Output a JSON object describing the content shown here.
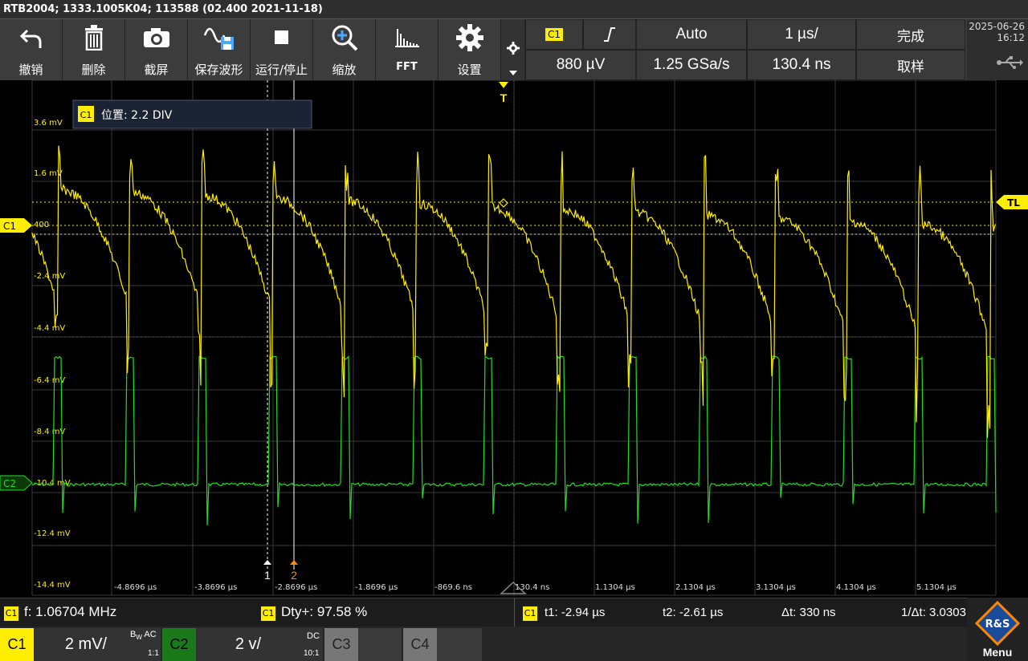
{
  "title_bar": "RTB2004; 1333.1005K04; 113588 (02.400 2021-11-18)",
  "toolbar": {
    "undo_label": "撤销",
    "delete_label": "删除",
    "screenshot_label": "截屏",
    "save_waveform_label": "保存波形",
    "run_stop_label": "运行/停止",
    "zoom_label": "缩放",
    "fft_label": "FFT",
    "settings_label": "设置"
  },
  "trigger": {
    "channel": "C1",
    "slope_icon": "rising-edge-icon",
    "mode": "Auto",
    "level": "880 µV",
    "sample_rate": "1.25 GSa/s"
  },
  "timebase": {
    "scale": "1 µs/",
    "offset": "130.4 ns"
  },
  "acquisition": {
    "status": "完成",
    "mode": "取样"
  },
  "datetime": {
    "date": "2025-06-26",
    "time": "16:12"
  },
  "usb_icon": "usb-icon",
  "position_tooltip": {
    "channel": "C1",
    "text": "位置: 2.2 DIV"
  },
  "markers": {
    "trigger": "T",
    "trigger_level": "TL",
    "ch1": "C1",
    "ch2": "C2",
    "cursor1": "1",
    "cursor2": "2"
  },
  "y_ticks": [
    "3.6 mV",
    "1.6 mV",
    "400",
    "-2.4 mV",
    "-4.4 mV",
    "-6.4 mV",
    "-8.4 mV",
    "-10.4 mV",
    "-12.4 mV",
    "-14.4 mV"
  ],
  "x_ticks": [
    "-4.8696 µs",
    "-3.8696 µs",
    "-2.8696 µs",
    "-1.8696 µs",
    "-869.6 ns",
    "130.4 ns",
    "1.1304 µs",
    "2.1304 µs",
    "3.1304 µs",
    "4.1304 µs",
    "5.1304 µs"
  ],
  "measurements": {
    "freq": "f: 1.06704 MHz",
    "duty": "Dty+: 97.58 %",
    "t1": "t1: -2.94 µs",
    "t2": "t2: -2.61 µs",
    "dt": "Δt: 330 ns",
    "inv_dt": "1/Δt: 3.0303 MHz",
    "tag": "C1"
  },
  "channels": {
    "c1": {
      "label": "C1",
      "scale": "2 mV/",
      "bw": "B",
      "bw_sub": "W",
      "coupling": "AC",
      "probe": "1:1"
    },
    "c2": {
      "label": "C2",
      "scale": "2 v/",
      "coupling": "DC",
      "probe": "10:1"
    },
    "c3": {
      "label": "C3"
    },
    "c4": {
      "label": "C4"
    }
  },
  "menu": {
    "logo": "R&S",
    "label": "Menu"
  },
  "colors": {
    "ch1": "#ffee00",
    "ch2": "#22dd22",
    "cursor2": "#ff8800"
  }
}
